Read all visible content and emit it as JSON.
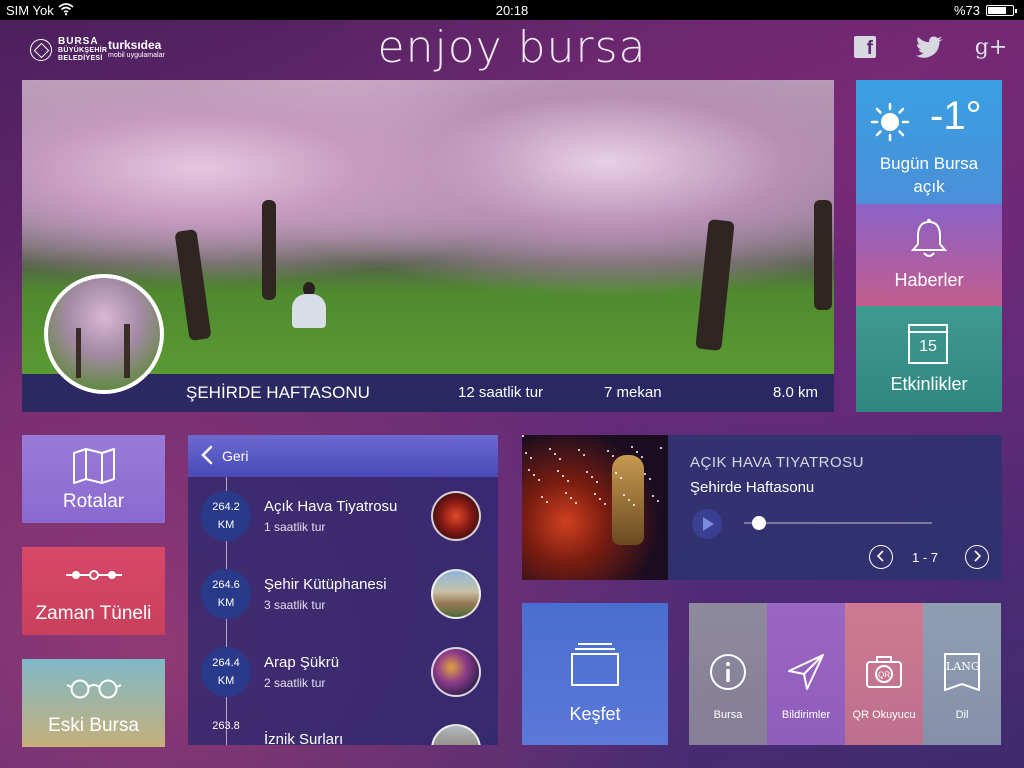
{
  "status_bar": {
    "carrier": "SIM Yok",
    "time": "20:18",
    "battery": "%73",
    "battery_level": 0.73
  },
  "header": {
    "logo_bursa": {
      "line1": "BURSA",
      "line2": "BÜYÜKŞEHİR",
      "line3": "BELEDİYESİ"
    },
    "logo_turks": {
      "name": "turksıdea",
      "tagline": "mobil uygulamalar"
    },
    "title": "enjoy bursa",
    "social": [
      {
        "icon": "facebook-icon",
        "label": "f"
      },
      {
        "icon": "twitter-icon",
        "label": ""
      },
      {
        "icon": "google-plus-icon",
        "label": "g+"
      }
    ]
  },
  "hero": {
    "title": "ŞEHİRDE HAFTASONU",
    "duration": "12 saatlik tur",
    "places": "7 mekan",
    "distance": "8.0 km"
  },
  "weather": {
    "temperature": "-1°",
    "description": "Bugün Bursa açık",
    "icon": "sun-icon",
    "color": "#3aa0e2"
  },
  "news_tile": {
    "label": "Haberler",
    "icon": "bell-icon"
  },
  "events_tile": {
    "label": "Etkinlikler",
    "icon": "calendar-icon",
    "day": "15"
  },
  "left_tiles": [
    {
      "label": "Rotalar",
      "icon": "map-icon"
    },
    {
      "label": "Zaman Tüneli",
      "icon": "timeline-icon"
    },
    {
      "label": "Eski Bursa",
      "icon": "glasses-icon"
    }
  ],
  "route_list": {
    "back_label": "Geri",
    "items": [
      {
        "km": "264.2",
        "unit": "KM",
        "name": "Açık Hava Tiyatrosu",
        "duration": "1 saatlik tur"
      },
      {
        "km": "264.6",
        "unit": "KM",
        "name": "Şehir Kütüphanesi",
        "duration": "3 saatlik tur"
      },
      {
        "km": "264.4",
        "unit": "KM",
        "name": "Arap Şükrü",
        "duration": "2 saatlik tur"
      },
      {
        "km": "263.8",
        "unit": "",
        "name": "İznik Surları",
        "duration": ""
      }
    ]
  },
  "player": {
    "title": "AÇIK HAVA TIYATROSU",
    "subtitle": "Şehirde Haftasonu",
    "progress": 0.08,
    "pager": "1 - 7"
  },
  "kesfet": {
    "label": "Keşfet",
    "icon": "folder-icon"
  },
  "menu": [
    {
      "label": "Bursa",
      "icon": "info-icon",
      "color": "#8e8a9c"
    },
    {
      "label": "Bildirimler",
      "icon": "paper-plane-icon",
      "color": "#9a66c4"
    },
    {
      "label": "QR Okuyucu",
      "icon": "qr-camera-icon",
      "color": "#cf7a92"
    },
    {
      "label": "Dil",
      "icon": "language-icon",
      "badge": "LANG",
      "color": "#8f9fb2"
    }
  ]
}
